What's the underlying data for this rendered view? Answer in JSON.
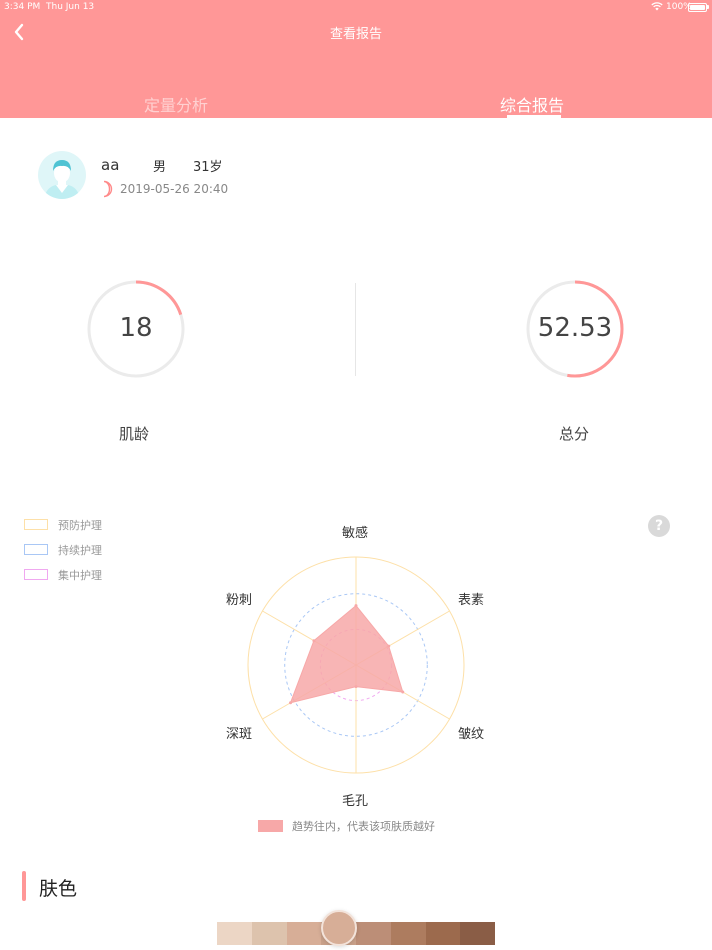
{
  "status_bar": {
    "time": "3:34 PM",
    "day": "Thu Jun 13",
    "battery": "100%"
  },
  "nav": {
    "title": "查看报告"
  },
  "tabs": [
    {
      "label": "定量分析",
      "active": false
    },
    {
      "label": "综合报告",
      "active": true
    }
  ],
  "user": {
    "name": "aa",
    "gender": "男",
    "age": "31岁",
    "datetime": "2019-05-26 20:40"
  },
  "scores": {
    "skin_age": {
      "value": "18",
      "label": "肌龄",
      "progress": 0.2
    },
    "total": {
      "value": "52.53",
      "label": "总分",
      "progress": 0.5253
    }
  },
  "legend": [
    {
      "label": "预防护理",
      "color": "#fde0a8"
    },
    {
      "label": "持续护理",
      "color": "#a9c7f5"
    },
    {
      "label": "集中护理",
      "color": "#f0a8f0"
    }
  ],
  "chart_data": {
    "type": "radar",
    "axes": [
      "敏感",
      "表素",
      "皱纹",
      "毛孔",
      "深斑",
      "粉刺"
    ],
    "rings": [
      {
        "level": 1.0,
        "color": "#fde0a8",
        "style": "solid"
      },
      {
        "level": 0.66,
        "color": "#a9c7f5",
        "style": "dashed"
      },
      {
        "level": 0.33,
        "color": "#f0a8f0",
        "style": "dashed"
      }
    ],
    "series": [
      {
        "values": [
          0.55,
          0.35,
          0.5,
          0.2,
          0.7,
          0.45
        ],
        "color": "#f7a8a8"
      }
    ]
  },
  "trend_note": "趋势往内，代表该项肤质越好",
  "section": {
    "title": "肤色"
  },
  "tone_scale": {
    "colors": [
      "#ecd6c5",
      "#ddc3ad",
      "#d7ae97",
      "#c9a18a",
      "#bc8e77",
      "#ad7c5f",
      "#9c6a4d",
      "#8a5d46"
    ],
    "selected_index": 3
  },
  "accent_color": "#ff9797"
}
